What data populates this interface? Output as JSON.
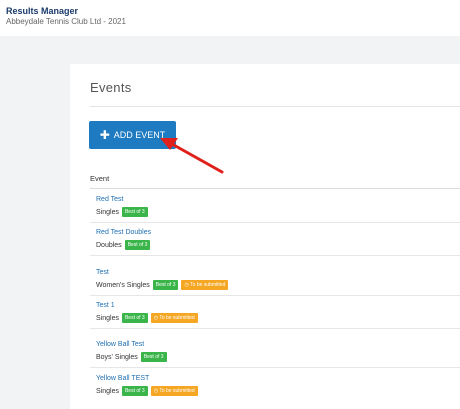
{
  "header": {
    "title": "Results Manager",
    "subtitle": "Abbeydale Tennis Club Ltd - 2021"
  },
  "card": {
    "title": "Events",
    "add_button_label": "ADD EVENT",
    "column_header": "Event"
  },
  "events": [
    {
      "name": "Red Test",
      "type": "Singles",
      "badge": "Best of 3",
      "status": ""
    },
    {
      "name": "Red Test Doubles",
      "type": "Doubles",
      "badge": "Best of 3",
      "status": ""
    },
    {
      "name": "Test",
      "type": "Women's Singles",
      "badge": "Best of 3",
      "status": "To be submitted"
    },
    {
      "name": "Test 1",
      "type": "Singles",
      "badge": "Best of 3",
      "status": "To be submitted"
    },
    {
      "name": "Yellow Ball Test",
      "type": "Boys' Singles",
      "badge": "Best of 3",
      "status": ""
    },
    {
      "name": "Yellow Ball TEST",
      "type": "Singles",
      "badge": "Best of 3",
      "status": "To be submitted"
    }
  ],
  "colors": {
    "accent": "#1f7bc1",
    "badge_green": "#3ab54a",
    "badge_orange": "#f5a623",
    "arrow": "#e0201b"
  },
  "icons": {
    "add": "plus-icon",
    "status": "clock-icon",
    "annotation": "red-arrow"
  }
}
